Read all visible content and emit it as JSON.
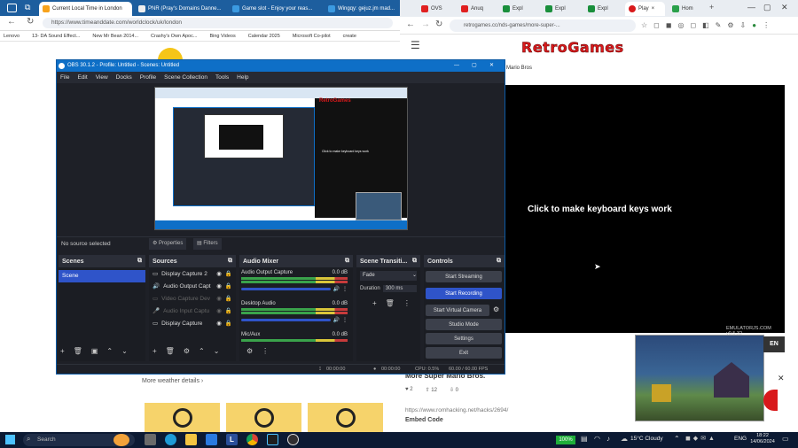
{
  "left_browser": {
    "tabs": [
      "Current Local Time in London",
      "PNR (Pray's Domains Danne...",
      "Game slot - Enjoy your reas...",
      "Wingqy: gejuz.jm mad..."
    ],
    "url": "https://www.timeanddate.com/worldclock/uk/london",
    "bookmarks": [
      "Lenovo",
      "13- DA Sound Effect...",
      "New Mr Bean 2014...",
      "Crashy's Own Apoc...",
      "Bing Videos",
      "Calendar 2025",
      "Microsoft Co-pilot",
      "create"
    ],
    "more_weather": "More weather details"
  },
  "right_browser": {
    "tabs": [
      "OVS",
      "Anuq",
      "Expl",
      "Expl",
      "Expl",
      "Play",
      "Hom"
    ],
    "url": "retrogames.cc/nds-games/more-super-...",
    "logo": "RetroGames",
    "subtitle": "Mario Bros",
    "click_msg": "Click to make keyboard keys work",
    "emulator_ver": "EMULATORJS.COM v0.5.32",
    "button_partial": "EN",
    "game_title": "More Super Mario Bros.",
    "votes": [
      "2",
      "12",
      "0"
    ],
    "hack_url": "https://www.romhacking.net/hacks/2694/",
    "embed": "Embed Code"
  },
  "obs": {
    "title": "OBS 30.1.2 - Profile: Untitled - Scenes: Untitled",
    "menu": [
      "File",
      "Edit",
      "View",
      "Docks",
      "Profile",
      "Scene Collection",
      "Tools",
      "Help"
    ],
    "no_source": "No source selected",
    "properties": "Properties",
    "filters": "Filters",
    "scenes_title": "Scenes",
    "scene_item": "Scene",
    "sources_title": "Sources",
    "sources": [
      "Display Capture 2",
      "Audio Output Capt",
      "Video Capture Dev",
      "Audio Input Captu",
      "Display Capture"
    ],
    "mixer_title": "Audio Mixer",
    "mixer": [
      {
        "name": "Audio Output Capture",
        "db": "0.0 dB"
      },
      {
        "name": "Desktop Audio",
        "db": "0.0 dB"
      },
      {
        "name": "Mic/Aux",
        "db": "0.0 dB"
      }
    ],
    "transitions_title": "Scene Transiti...",
    "fade": "Fade",
    "duration_label": "Duration",
    "duration_val": "300 ms",
    "controls_title": "Controls",
    "controls": [
      "Start Streaming",
      "Start Recording",
      "Start Virtual Camera",
      "Studio Mode",
      "Settings",
      "Exit"
    ],
    "status": [
      "00:00:00",
      "00:00:00",
      "CPU: 0.5%",
      "60.00 / 60.00 FPS"
    ],
    "preview_logo": "RetroGames",
    "preview_msg": "Click to make keyboard keys work"
  },
  "taskbar": {
    "search": "Search",
    "battery": "100%",
    "weather": "15°C Cloudy",
    "lang": "ENG",
    "time": "18:22",
    "date": "14/06/2024"
  },
  "colors": {
    "obs_bg": "#1e2027",
    "obs_accent": "#2f54c9",
    "taskbar": "#0c1a33",
    "brand_red": "#d8191b"
  }
}
